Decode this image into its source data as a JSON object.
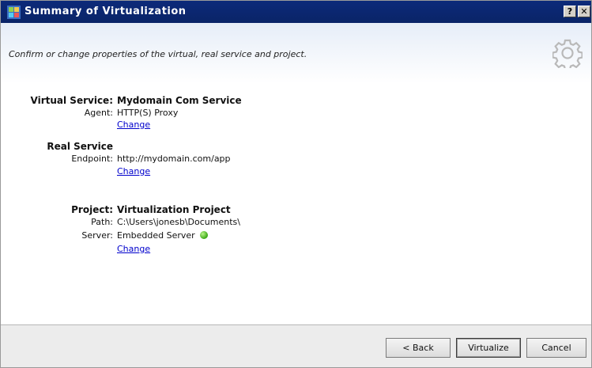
{
  "window": {
    "title": "Summary of Virtualization",
    "help_button": "?",
    "close_button": "✕"
  },
  "header": {
    "description": "Confirm or change properties of the virtual, real service and project."
  },
  "virtual_service": {
    "label": "Virtual Service:",
    "name": "Mydomain Com Service",
    "agent_label": "Agent:",
    "agent_value": "HTTP(S) Proxy",
    "change_link": "Change"
  },
  "real_service": {
    "label": "Real Service",
    "endpoint_label": "Endpoint:",
    "endpoint_value": "http://mydomain.com/app",
    "change_link": "Change"
  },
  "project": {
    "label": "Project:",
    "name": "Virtualization Project",
    "path_label": "Path:",
    "path_value": "C:\\Users\\jonesb\\Documents\\",
    "server_label": "Server:",
    "server_value": "Embedded Server",
    "server_status_color": "#3aa814",
    "change_link": "Change"
  },
  "footer": {
    "back_label": "< Back",
    "virtualize_label": "Virtualize",
    "cancel_label": "Cancel"
  },
  "icons": {
    "app_icon": "wizard-app-icon",
    "header_icon": "gear-icon",
    "status_icon": "status-dot-icon"
  }
}
